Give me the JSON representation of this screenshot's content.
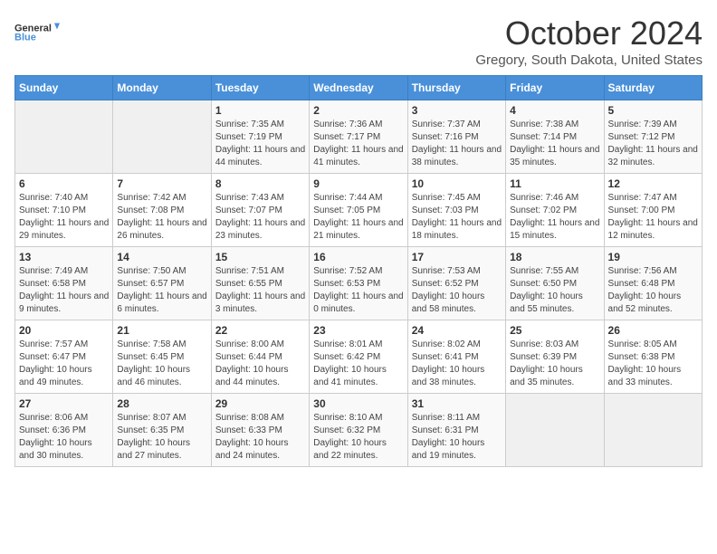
{
  "logo": {
    "line1": "General",
    "line2": "Blue"
  },
  "title": "October 2024",
  "subtitle": "Gregory, South Dakota, United States",
  "headers": [
    "Sunday",
    "Monday",
    "Tuesday",
    "Wednesday",
    "Thursday",
    "Friday",
    "Saturday"
  ],
  "rows": [
    [
      {
        "day": "",
        "info": ""
      },
      {
        "day": "",
        "info": ""
      },
      {
        "day": "1",
        "info": "Sunrise: 7:35 AM\nSunset: 7:19 PM\nDaylight: 11 hours and 44 minutes."
      },
      {
        "day": "2",
        "info": "Sunrise: 7:36 AM\nSunset: 7:17 PM\nDaylight: 11 hours and 41 minutes."
      },
      {
        "day": "3",
        "info": "Sunrise: 7:37 AM\nSunset: 7:16 PM\nDaylight: 11 hours and 38 minutes."
      },
      {
        "day": "4",
        "info": "Sunrise: 7:38 AM\nSunset: 7:14 PM\nDaylight: 11 hours and 35 minutes."
      },
      {
        "day": "5",
        "info": "Sunrise: 7:39 AM\nSunset: 7:12 PM\nDaylight: 11 hours and 32 minutes."
      }
    ],
    [
      {
        "day": "6",
        "info": "Sunrise: 7:40 AM\nSunset: 7:10 PM\nDaylight: 11 hours and 29 minutes."
      },
      {
        "day": "7",
        "info": "Sunrise: 7:42 AM\nSunset: 7:08 PM\nDaylight: 11 hours and 26 minutes."
      },
      {
        "day": "8",
        "info": "Sunrise: 7:43 AM\nSunset: 7:07 PM\nDaylight: 11 hours and 23 minutes."
      },
      {
        "day": "9",
        "info": "Sunrise: 7:44 AM\nSunset: 7:05 PM\nDaylight: 11 hours and 21 minutes."
      },
      {
        "day": "10",
        "info": "Sunrise: 7:45 AM\nSunset: 7:03 PM\nDaylight: 11 hours and 18 minutes."
      },
      {
        "day": "11",
        "info": "Sunrise: 7:46 AM\nSunset: 7:02 PM\nDaylight: 11 hours and 15 minutes."
      },
      {
        "day": "12",
        "info": "Sunrise: 7:47 AM\nSunset: 7:00 PM\nDaylight: 11 hours and 12 minutes."
      }
    ],
    [
      {
        "day": "13",
        "info": "Sunrise: 7:49 AM\nSunset: 6:58 PM\nDaylight: 11 hours and 9 minutes."
      },
      {
        "day": "14",
        "info": "Sunrise: 7:50 AM\nSunset: 6:57 PM\nDaylight: 11 hours and 6 minutes."
      },
      {
        "day": "15",
        "info": "Sunrise: 7:51 AM\nSunset: 6:55 PM\nDaylight: 11 hours and 3 minutes."
      },
      {
        "day": "16",
        "info": "Sunrise: 7:52 AM\nSunset: 6:53 PM\nDaylight: 11 hours and 0 minutes."
      },
      {
        "day": "17",
        "info": "Sunrise: 7:53 AM\nSunset: 6:52 PM\nDaylight: 10 hours and 58 minutes."
      },
      {
        "day": "18",
        "info": "Sunrise: 7:55 AM\nSunset: 6:50 PM\nDaylight: 10 hours and 55 minutes."
      },
      {
        "day": "19",
        "info": "Sunrise: 7:56 AM\nSunset: 6:48 PM\nDaylight: 10 hours and 52 minutes."
      }
    ],
    [
      {
        "day": "20",
        "info": "Sunrise: 7:57 AM\nSunset: 6:47 PM\nDaylight: 10 hours and 49 minutes."
      },
      {
        "day": "21",
        "info": "Sunrise: 7:58 AM\nSunset: 6:45 PM\nDaylight: 10 hours and 46 minutes."
      },
      {
        "day": "22",
        "info": "Sunrise: 8:00 AM\nSunset: 6:44 PM\nDaylight: 10 hours and 44 minutes."
      },
      {
        "day": "23",
        "info": "Sunrise: 8:01 AM\nSunset: 6:42 PM\nDaylight: 10 hours and 41 minutes."
      },
      {
        "day": "24",
        "info": "Sunrise: 8:02 AM\nSunset: 6:41 PM\nDaylight: 10 hours and 38 minutes."
      },
      {
        "day": "25",
        "info": "Sunrise: 8:03 AM\nSunset: 6:39 PM\nDaylight: 10 hours and 35 minutes."
      },
      {
        "day": "26",
        "info": "Sunrise: 8:05 AM\nSunset: 6:38 PM\nDaylight: 10 hours and 33 minutes."
      }
    ],
    [
      {
        "day": "27",
        "info": "Sunrise: 8:06 AM\nSunset: 6:36 PM\nDaylight: 10 hours and 30 minutes."
      },
      {
        "day": "28",
        "info": "Sunrise: 8:07 AM\nSunset: 6:35 PM\nDaylight: 10 hours and 27 minutes."
      },
      {
        "day": "29",
        "info": "Sunrise: 8:08 AM\nSunset: 6:33 PM\nDaylight: 10 hours and 24 minutes."
      },
      {
        "day": "30",
        "info": "Sunrise: 8:10 AM\nSunset: 6:32 PM\nDaylight: 10 hours and 22 minutes."
      },
      {
        "day": "31",
        "info": "Sunrise: 8:11 AM\nSunset: 6:31 PM\nDaylight: 10 hours and 19 minutes."
      },
      {
        "day": "",
        "info": ""
      },
      {
        "day": "",
        "info": ""
      }
    ]
  ]
}
